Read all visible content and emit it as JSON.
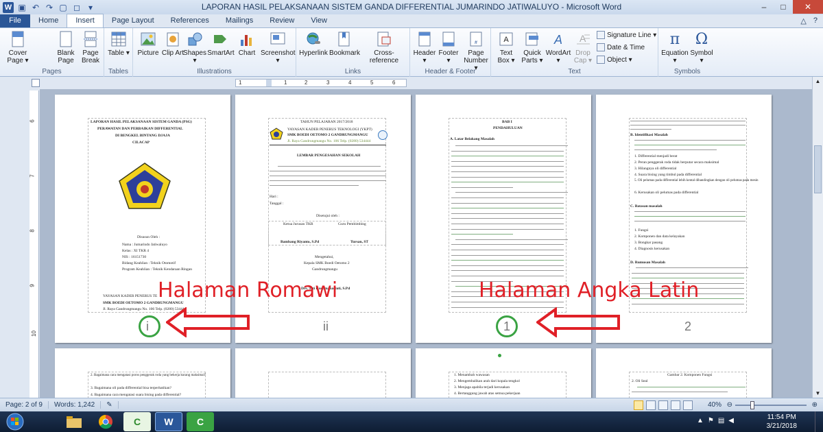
{
  "window": {
    "title": "LAPORAN HASIL PELAKSANAAN SISTEM GANDA DIFFERENTIAL JUMARINDO JATIWALUYO  -  Microsoft Word",
    "controls": {
      "minimize": "–",
      "maximize": "□",
      "close": "✕"
    }
  },
  "tabs": [
    "File",
    "Home",
    "Insert",
    "Page Layout",
    "References",
    "Mailings",
    "Review",
    "View"
  ],
  "active_tab": "Insert",
  "ribbon": {
    "groups": {
      "pages": "Pages",
      "tables": "Tables",
      "illustrations": "Illustrations",
      "links": "Links",
      "header_footer": "Header & Footer",
      "text": "Text",
      "symbols": "Symbols"
    },
    "buttons": {
      "cover_page": "Cover Page ▾",
      "blank_page": "Blank Page",
      "page_break": "Page Break",
      "table": "Table ▾",
      "picture": "Picture",
      "clip_art": "Clip Art",
      "shapes": "Shapes ▾",
      "smartart": "SmartArt",
      "chart": "Chart",
      "screenshot": "Screenshot ▾",
      "hyperlink": "Hyperlink",
      "bookmark": "Bookmark",
      "cross_reference": "Cross-reference",
      "header": "Header ▾",
      "footer": "Footer ▾",
      "page_number": "Page Number ▾",
      "text_box": "Text Box ▾",
      "quick_parts": "Quick Parts ▾",
      "wordart": "WordArt ▾",
      "drop_cap": "Drop Cap ▾",
      "signature_line": "Signature Line ▾",
      "date_time": "Date & Time",
      "object": "Object ▾",
      "equation": "Equation ▾",
      "symbol": "Symbol ▾"
    }
  },
  "ruler": {
    "ticks": [
      "1",
      "1",
      "2",
      "3",
      "4",
      "5",
      "6"
    ]
  },
  "vruler": {
    "ticks": [
      "6",
      "7",
      "8",
      "9",
      "10"
    ]
  },
  "pages": [
    {
      "number": "i",
      "title_lines": [
        "LAPORAN HASIL PELAKSANAAN SISTEM GANDA (PSG)",
        "PERAWATAN DAN PERBAIKAN DIFFERENTIAL",
        "DI BENGKEL BINTANG DJAJA",
        "CILACAP"
      ],
      "logo_text": "YAYASAN KADER PENERUS TEKNOLOGI",
      "form_lines": [
        "Disusun Oleh :",
        "Nama        : Jumarindo Jatiwaluyo",
        "Kelas        : XI TKR 4",
        "NIS          : 16151730",
        "Bidang Keahlian : Teknik Otomotif",
        "Program Keahlian : Teknik Kendaraan Ringan"
      ],
      "footer_lines": [
        "YAYASAN KADER PENERUS TE",
        "SMK BOEDI OETOMO 2 GANDRUNGMANGU",
        "Jl. Raya Gandrungmangu No. 106 Telp. (0280) 534444"
      ]
    },
    {
      "number": "ii",
      "header_lines": [
        "TAHUN PELAJARAN 2017/2018",
        "YAYASAN KADER PENERUS TEKNOLOGI (YKPT)",
        "SMK BOEDI OETOMO 2 GANDRUNGMANGU",
        "Jl. Raya Gandrungmangu No. 106 Telp. (0280) 534444"
      ],
      "heading": "LEMBAR PENGESAHAN SEKOLAH",
      "fields": [
        "Hari          :",
        "Tanggal      :"
      ],
      "sign": [
        "Disetujui oleh :",
        "Ketua Jurusan TKR",
        "Guru Pembimbing",
        "Bambang Riyanto, S.Pd",
        "Tursan, ST",
        "Mengetahui,",
        "Kepala SMK Boedi Oetomo 2",
        "Gandrungmangu",
        "Drs. Teti Kusumahastuti, S.Pd"
      ]
    },
    {
      "number": "1",
      "heading": [
        "BAB I",
        "PENDAHULUAN"
      ],
      "subheading": "A.  Latar Belakang Masalah"
    },
    {
      "number": "2",
      "items": [
        "B.  Identifikasi Masalah",
        "1.  Differential menjadi berat",
        "2.  Peran penggerak roda tidak berputar secara maksimal",
        "3.  Hilangnya oli differential",
        "4.  Suara bising yang timbul pada differential",
        "5.  Oli pelumas pada differential lebih kental dibandingkan dengan oli pelumas pada mesin",
        "6.  Kerusakan oli pelumas pada differential",
        "C.  Batasan masalah",
        "1.  Fungsi",
        "2.  Komponen dan data kelayakan",
        "3.  Bongkar pasang",
        "4.  Diagnosis kerusakan",
        "D.  Rumusan Masalah"
      ]
    },
    {
      "number": "",
      "items": [
        "2.  Bagaimana cara mengatasi poros penggerak roda yang bekerja kurang maksimal?",
        "3.  Bagaimana oli pada differential bisa terperhatikan?",
        "4.  Bagaimana cara mengatasi suara bising pada differential?"
      ]
    },
    {
      "number": ""
    },
    {
      "number": "",
      "items": [
        "1.  Menambah wawasan",
        "2.  Mengembalikan arah dari kopala tengkol",
        "3.  Menjaga apabila terjadi kerusakan",
        "4.  Bertanggung jawab atas semua pekerjaan"
      ]
    },
    {
      "number": "",
      "items": [
        "Gambar 2. Komponen Fungsi",
        "2.  Oli Seal"
      ]
    }
  ],
  "annotations": {
    "left": "Halaman Romawi",
    "right": "Halaman Angka Latin"
  },
  "status": {
    "page": "Page: 2 of 9",
    "words": "Words: 1,242",
    "zoom": "40%"
  },
  "taskbar": {
    "time": "11:54 PM",
    "date": "3/21/2018"
  },
  "colors": {
    "word_blue": "#2b579a",
    "annotation_red": "#e02027",
    "circle_green": "#3aa343"
  }
}
